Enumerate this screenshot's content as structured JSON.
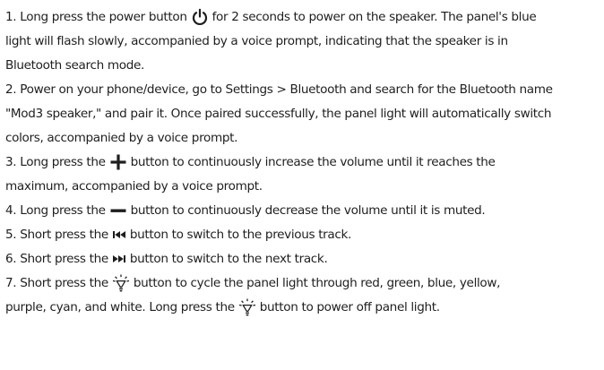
{
  "instructions": {
    "step1": {
      "a": "1. Long press the power button",
      "b": "for 2 seconds to power on the speaker. The panel's blue",
      "c": "light will flash slowly, accompanied by a voice prompt, indicating that the speaker is in",
      "d": "Bluetooth search mode.",
      "icon": "power-icon"
    },
    "step2": {
      "a": "2. Power on your phone/device, go to Settings > Bluetooth and search for the Bluetooth name",
      "b": "\"Mod3 speaker,\" and pair it. Once paired successfully, the panel light will automatically switch",
      "c": "colors, accompanied by a voice prompt."
    },
    "step3": {
      "a": "3. Long press the",
      "b": "button to continuously increase the volume until it reaches the",
      "c": "maximum, accompanied by a voice prompt.",
      "icon": "plus-icon"
    },
    "step4": {
      "a": "4. Long press the",
      "b": "button to continuously decrease the volume until it is muted.",
      "icon": "minus-icon"
    },
    "step5": {
      "a": "5. Short press the",
      "b": "button to switch to the previous track.",
      "icon": "previous-track-icon"
    },
    "step6": {
      "a": "6. Short press the",
      "b": "button to switch to the next track.",
      "icon": "next-track-icon"
    },
    "step7": {
      "a": "7. Short press the",
      "b": "button to cycle the panel light through red, green, blue, yellow,",
      "c": "purple, cyan, and white. Long press the",
      "d": "button to power off panel light.",
      "icon": "light-bulb-icon"
    }
  }
}
